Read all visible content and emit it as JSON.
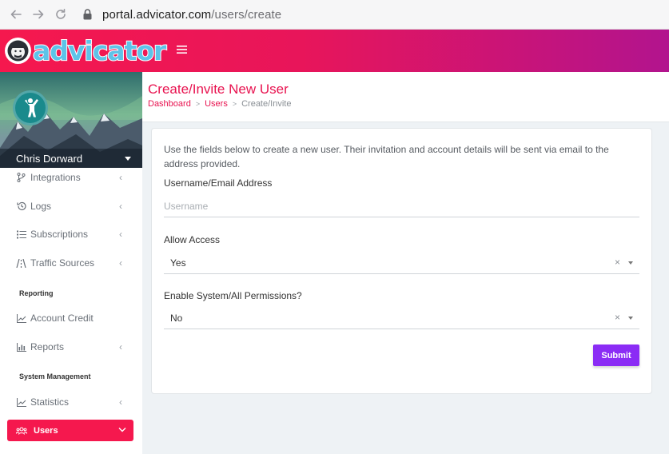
{
  "browser": {
    "url_host": "portal.advicator.com",
    "url_path": "/users/create"
  },
  "header": {
    "logo_text": "advicator",
    "menu_icon": "hamburger-icon"
  },
  "sidebar": {
    "user_name": "Chris Dorward",
    "items": [
      {
        "label": "Integrations",
        "icon": "branch-icon"
      },
      {
        "label": "Logs",
        "icon": "history-icon"
      },
      {
        "label": "Subscriptions",
        "icon": "list-icon"
      },
      {
        "label": "Traffic Sources",
        "icon": "road-icon"
      },
      {
        "label": "Account Credit",
        "icon": "line-chart-icon"
      },
      {
        "label": "Reports",
        "icon": "bar-chart-icon"
      },
      {
        "label": "Statistics",
        "icon": "line-chart-icon"
      }
    ],
    "sections": {
      "reporting": "Reporting",
      "system_management": "System Management"
    },
    "active": {
      "label": "Users",
      "icon": "users-icon"
    }
  },
  "page": {
    "title": "Create/Invite New User",
    "breadcrumb": [
      "Dashboard",
      "Users",
      "Create/Invite"
    ]
  },
  "form": {
    "intro": "Use the fields below to create a new user. Their invitation and account details will be sent via email to the address provided.",
    "username_label": "Username/Email Address",
    "username_placeholder": "Username",
    "username_value": "",
    "allow_access_label": "Allow Access",
    "allow_access_value": "Yes",
    "permissions_label": "Enable System/All Permissions?",
    "permissions_value": "No",
    "clear_symbol": "×",
    "submit_label": "Submit"
  },
  "colors": {
    "brand": "#f5184e",
    "accent_purple": "#8b2cf5",
    "header_gradient_end": "#b2148e"
  }
}
